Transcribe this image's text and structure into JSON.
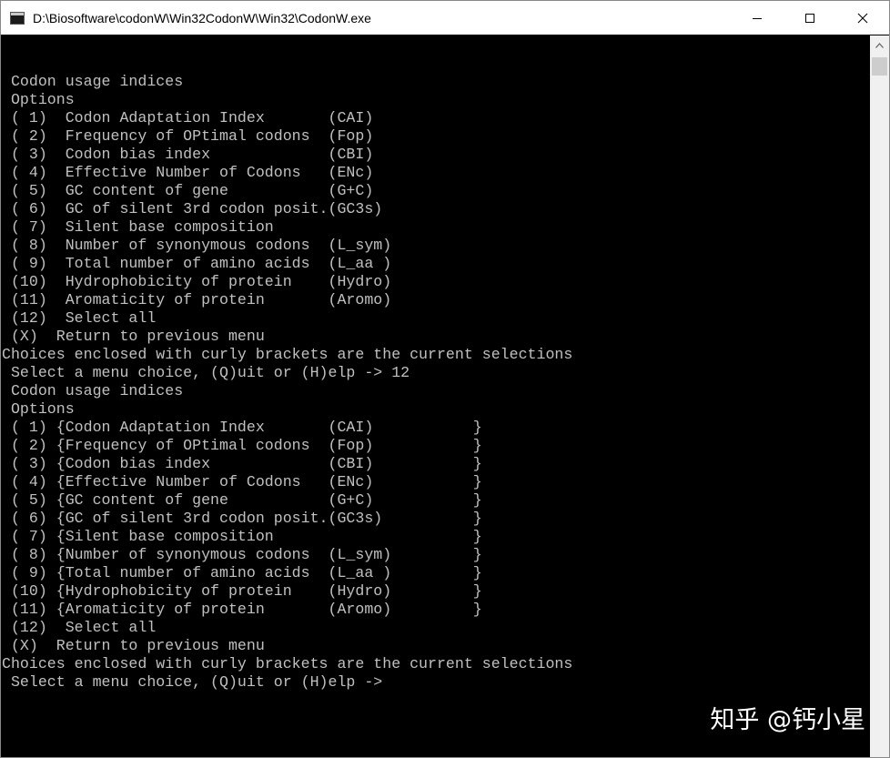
{
  "window": {
    "title": "D:\\Biosoftware\\codonW\\Win32CodonW\\Win32\\CodonW.exe",
    "controls": {
      "minimize_icon": "minimize-icon",
      "maximize_icon": "maximize-icon",
      "close_icon": "close-icon"
    }
  },
  "console": {
    "lines": [
      " Codon usage indices",
      " Options",
      " ( 1)  Codon Adaptation Index       (CAI)",
      " ( 2)  Frequency of OPtimal codons  (Fop)",
      " ( 3)  Codon bias index             (CBI)",
      " ( 4)  Effective Number of Codons   (ENc)",
      " ( 5)  GC content of gene           (G+C)",
      " ( 6)  GC of silent 3rd codon posit.(GC3s)",
      " ( 7)  Silent base composition",
      " ( 8)  Number of synonymous codons  (L_sym)",
      " ( 9)  Total number of amino acids  (L_aa )",
      " (10)  Hydrophobicity of protein    (Hydro)",
      " (11)  Aromaticity of protein       (Aromo)",
      " (12)  Select all",
      " (X)  Return to previous menu",
      "Choices enclosed with curly brackets are the current selections",
      " Select a menu choice, (Q)uit or (H)elp -> 12",
      " Codon usage indices",
      " Options",
      " ( 1) {Codon Adaptation Index       (CAI)           }",
      " ( 2) {Frequency of OPtimal codons  (Fop)           }",
      " ( 3) {Codon bias index             (CBI)           }",
      " ( 4) {Effective Number of Codons   (ENc)           }",
      " ( 5) {GC content of gene           (G+C)           }",
      " ( 6) {GC of silent 3rd codon posit.(GC3s)          }",
      " ( 7) {Silent base composition                      }",
      " ( 8) {Number of synonymous codons  (L_sym)         }",
      " ( 9) {Total number of amino acids  (L_aa )         }",
      " (10) {Hydrophobicity of protein    (Hydro)         }",
      " (11) {Aromaticity of protein       (Aromo)         }",
      " (12)  Select all",
      " (X)  Return to previous menu",
      "Choices enclosed with curly brackets are the current selections",
      " Select a menu choice, (Q)uit or (H)elp ->"
    ]
  },
  "watermark": "知乎 @钙小星",
  "colors": {
    "console_bg": "#000000",
    "console_fg": "#c0c0c0",
    "titlebar_bg": "#ffffff"
  }
}
